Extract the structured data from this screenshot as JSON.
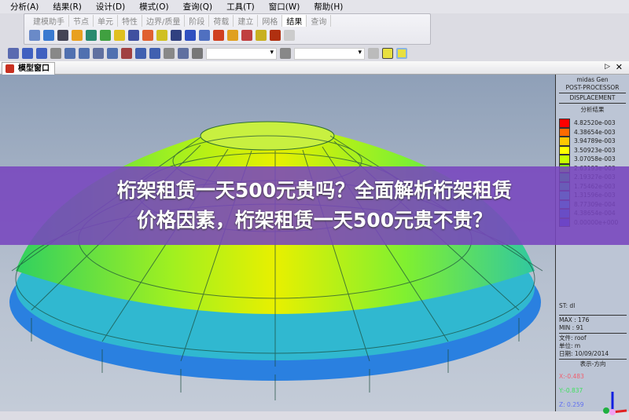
{
  "menu": [
    "分析(A)",
    "结果(R)",
    "设计(D)",
    "模式(O)",
    "查询(Q)",
    "工具(T)",
    "窗口(W)",
    "帮助(H)"
  ],
  "ribbon_tabs": [
    "建模助手",
    "节点",
    "单元",
    "特性",
    "边界/质量",
    "阶段",
    "荷载",
    "建立",
    "网格",
    "结果",
    "查询"
  ],
  "active_ribbon_tab": "结果",
  "model_tab": "模型窗口",
  "panel": {
    "line1": "midas Gen",
    "line2": "POST-PROCESSOR",
    "line3": "DISPLACEMENT",
    "subtitle": "分析结果",
    "legend": [
      {
        "value": "4.82520e-003",
        "color": "#ff0000"
      },
      {
        "value": "4.38654e-003",
        "color": "#ff6a00"
      },
      {
        "value": "3.94789e-003",
        "color": "#ffc800"
      },
      {
        "value": "3.50923e-003",
        "color": "#ffff00"
      },
      {
        "value": "3.07058e-003",
        "color": "#c8ff00"
      },
      {
        "value": "2.63193e-003",
        "color": "#80ff00"
      },
      {
        "value": "2.19327e-003",
        "color": "#00ff40"
      },
      {
        "value": "1.75462e-003",
        "color": "#00ff80"
      },
      {
        "value": "1.31596e-003",
        "color": "#00ffc8"
      },
      {
        "value": "8.77309e-004",
        "color": "#00c8ff"
      },
      {
        "value": "4.38654e-004",
        "color": "#0080ff"
      },
      {
        "value": "0.00000e+000",
        "color": "#2040ff"
      }
    ],
    "st": "ST: dl",
    "max": "MAX : 176",
    "min": "MIN : 91",
    "file": "文件: roof",
    "unit": "单位: m",
    "date": "日期: 10/09/2014",
    "view": "表示-方向",
    "x": "X:-0.483",
    "y": "Y:-0.837",
    "z": "Z: 0.259"
  },
  "banner": {
    "line1": "桁架租赁一天500元贵吗？全面解析桁架租赁",
    "line2": "价格因素，桁架租赁一天500元贵不贵？"
  }
}
